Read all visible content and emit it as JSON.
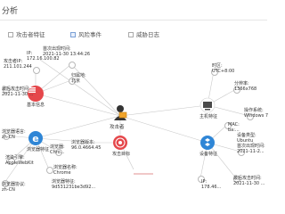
{
  "header": {
    "title": "分析"
  },
  "tabs": [
    {
      "label": "攻击者特征"
    },
    {
      "label": "风险事件"
    },
    {
      "label": "威胁日志"
    }
  ],
  "center": {
    "label": "攻击者"
  },
  "hubs": {
    "baseinfo": {
      "label": "基本信息",
      "color": "#e5474b"
    },
    "browser": {
      "label": "浏览器特征",
      "color": "#2f86d6"
    },
    "target": {
      "label": "攻击目标",
      "color": "#e5474b"
    },
    "host": {
      "label": "主机特征",
      "color": "#4a4a4a"
    },
    "device": {
      "label": "设备特征",
      "color": "#2f86d6"
    }
  },
  "labels": {
    "attacker_ip": [
      "攻击者IP:",
      "211.101.244"
    ],
    "first_seen": [
      "首次出现时间:",
      "2021-11-30 13:44:26"
    ],
    "ip_addr": [
      "IP:",
      "172.16.100.82"
    ],
    "location": [
      "归属地:",
      "北京"
    ],
    "last_attack": [
      "最后攻击时间:",
      "2021-11-30 ..."
    ],
    "timezone": [
      "时区:",
      "UTC+8:00"
    ],
    "resolution": [
      "分辨率:",
      "1366x768"
    ],
    "os": [
      "操作系统:",
      "Windows 7"
    ],
    "mac": [
      "MAC:",
      "ba:..."
    ],
    "device_type": [
      "设备类型:",
      "Ubuntu"
    ],
    "first_dev": [
      "首次出现时间:",
      "2021-11-2..."
    ],
    "browser_lang": [
      "浏览器语言:",
      "zh-CN"
    ],
    "chrome": [
      "浏览器:",
      "Chro..."
    ],
    "webkit": [
      "渲染引擎:",
      "AppleWebKit"
    ],
    "browser_name": [
      "浏览器名称:",
      "Chrome"
    ],
    "hash": [
      "浏览器特征:",
      "9d531231be3d92..."
    ],
    "browser_ver": [
      "浏览器版本:",
      "96.0.4664.45"
    ],
    "proto": [
      "浏览器协议:",
      "zh-CN"
    ],
    "target_ip": [
      "IP:",
      "178.46..."
    ],
    "target_time": [
      "最后攻击时间:",
      "2021-11-30 ..."
    ]
  }
}
